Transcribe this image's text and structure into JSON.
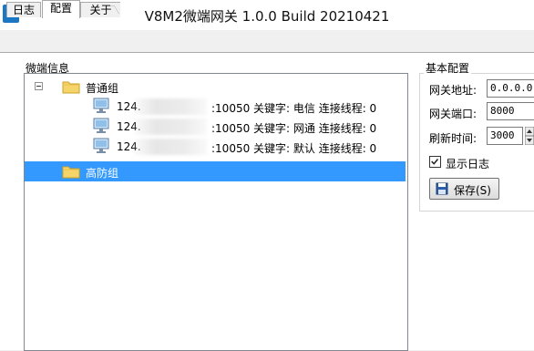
{
  "window": {
    "icon_letter": "V",
    "title": "V8M2微端网关 1.0.0 Build 20210421"
  },
  "tabs": [
    {
      "label": "日志"
    },
    {
      "label": "配置"
    },
    {
      "label": "关于"
    }
  ],
  "tree_group": {
    "label": "微端信息",
    "nodes": [
      {
        "label": "普通组",
        "expanded": true
      },
      {
        "label": "124.",
        "suffix": ":10050 关键字: 电信 连接线程: 0"
      },
      {
        "label": "124.",
        "suffix": ":10050 关键字: 网通 连接线程: 0"
      },
      {
        "label": "124.",
        "suffix": ":10050 关键字: 默认 连接线程: 0"
      },
      {
        "label": "高防组",
        "selected": true
      }
    ]
  },
  "config": {
    "title": "基本配置",
    "gateway_address_label": "网关地址:",
    "gateway_address_value": "0.0.0.0",
    "gateway_port_label": "网关端口:",
    "gateway_port_value": "8000",
    "refresh_time_label": "刷新时间:",
    "refresh_time_value": "3000",
    "show_log_label": "显示日志",
    "show_log_checked": true,
    "save_label": "保存(S)"
  },
  "colors": {
    "selection": "#3399ff",
    "app_icon": "#1b76c4"
  }
}
